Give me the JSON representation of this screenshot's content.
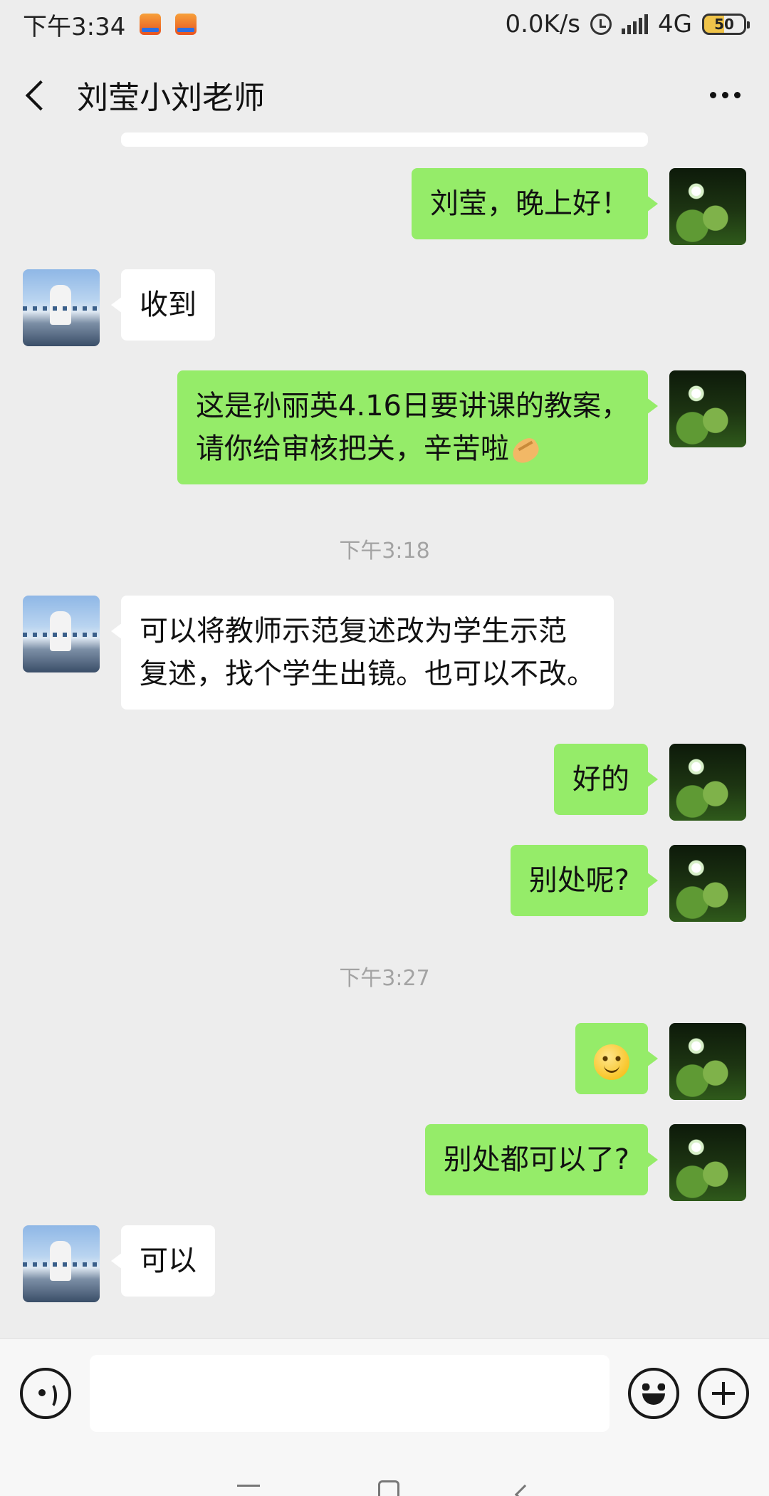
{
  "status_bar": {
    "time": "下午3:34",
    "network_speed": "0.0K/s",
    "network_type": "4G",
    "battery": "50",
    "badge_icons": [
      "kuaibao-app-icon",
      "kuaibao-app-icon"
    ]
  },
  "header": {
    "title": "刘莹小刘老师"
  },
  "messages": [
    {
      "side": "sent",
      "text": "刘莹，晚上好！"
    },
    {
      "side": "recv",
      "text": "收到"
    },
    {
      "side": "sent",
      "lines": [
        "这是孙丽英4.16日要讲课的教案，",
        "请你给审核把关，辛苦啦"
      ],
      "trailing_emoji": "folded-hands-emoji"
    },
    {
      "side": "time",
      "text": "下午3:18"
    },
    {
      "side": "recv",
      "lines": [
        "可以将教师示范复述改为学生示范",
        "复述，找个学生出镜。也可以不改。"
      ]
    },
    {
      "side": "sent",
      "text": "好的"
    },
    {
      "side": "sent",
      "text": "别处呢?"
    },
    {
      "side": "time",
      "text": "下午3:27"
    },
    {
      "side": "sent",
      "emoji": "smile-emoji"
    },
    {
      "side": "sent",
      "text": "别处都可以了?"
    },
    {
      "side": "recv",
      "text": "可以"
    }
  ],
  "input_bar": {
    "value": "",
    "icons": [
      "voice-icon",
      "emoji-icon",
      "plus-icon"
    ]
  },
  "colors": {
    "background": "#ededed",
    "sent_bubble": "#95ec69",
    "recv_bubble": "#ffffff",
    "timestamp": "#a3a3a3"
  }
}
